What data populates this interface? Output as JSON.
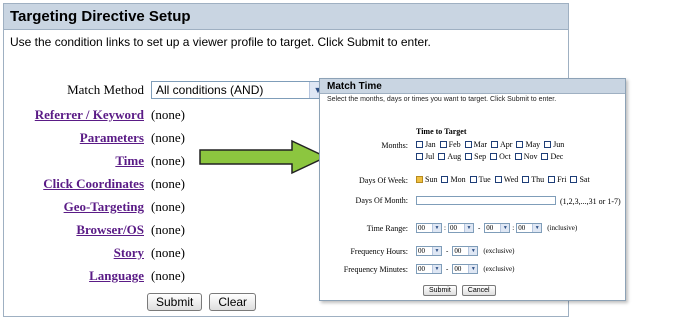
{
  "left_panel": {
    "title": "Targeting Directive Setup",
    "subtitle": "Use the condition links to set up a viewer profile to target. Click Submit to enter.",
    "match_method": {
      "label": "Match Method",
      "value": "All conditions (AND)"
    },
    "conditions": [
      {
        "label": "Referrer / Keyword",
        "value": "(none)"
      },
      {
        "label": "Parameters",
        "value": "(none)"
      },
      {
        "label": "Time",
        "value": "(none)"
      },
      {
        "label": "Click Coordinates",
        "value": "(none)"
      },
      {
        "label": "Geo-Targeting",
        "value": "(none)"
      },
      {
        "label": "Browser/OS",
        "value": "(none)"
      },
      {
        "label": "Story",
        "value": "(none)"
      },
      {
        "label": "Language",
        "value": "(none)"
      }
    ],
    "submit_label": "Submit",
    "clear_label": "Clear"
  },
  "right_panel": {
    "title": "Match Time",
    "subtitle": "Select the months, days or times you want to target. Click Submit to enter.",
    "section_heading": "Time to Target",
    "months_label": "Months:",
    "months_row1": [
      "Jan",
      "Feb",
      "Mar",
      "Apr",
      "May",
      "Jun"
    ],
    "months_row2": [
      "Jul",
      "Aug",
      "Sep",
      "Oct",
      "Nov",
      "Dec"
    ],
    "days_of_week_label": "Days Of Week:",
    "days_of_week": [
      "Sun",
      "Mon",
      "Tue",
      "Wed",
      "Thu",
      "Fri",
      "Sat"
    ],
    "days_of_month_label": "Days Of Month:",
    "days_of_month_hint": "(1,2,3,...,31 or 1-7)",
    "time_range_label": "Time Range:",
    "time_range_values": [
      "00",
      "00",
      "00",
      "00"
    ],
    "time_range_colon": ":",
    "time_range_dash": "-",
    "time_range_note": "(inclusive)",
    "freq_hours_label": "Frequency Hours:",
    "freq_hours_values": [
      "00",
      "00"
    ],
    "freq_hours_note": "(exclusive)",
    "freq_minutes_label": "Frequency Minutes:",
    "freq_minutes_values": [
      "00",
      "00"
    ],
    "freq_minutes_note": "(exclusive)",
    "submit_label": "Submit",
    "cancel_label": "Cancel"
  },
  "colors": {
    "titlebar": "#c9d5e2",
    "link": "#5a1b86",
    "arrow": "#8cc63f"
  },
  "icons": {
    "dropdown": "chevron-down-icon",
    "arrow": "right-arrow-icon"
  }
}
